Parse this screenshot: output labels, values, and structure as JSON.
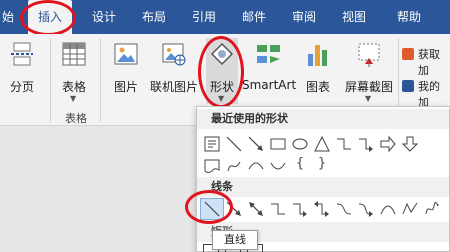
{
  "tabs": [
    {
      "label": "始"
    },
    {
      "label": "插入"
    },
    {
      "label": "设计"
    },
    {
      "label": "布局"
    },
    {
      "label": "引用"
    },
    {
      "label": "邮件"
    },
    {
      "label": "审阅"
    },
    {
      "label": "视图"
    },
    {
      "label": "帮助"
    }
  ],
  "ribbon": {
    "page_break": "分页",
    "table": "表格",
    "table_group": "表格",
    "picture": "图片",
    "online_picture": "联机图片",
    "shapes": "形状",
    "smartart": "SmartArt",
    "chart": "图表",
    "screenshot": "屏幕截图",
    "get_addins": "获取加",
    "my_addins": "我的加"
  },
  "shapes_panel": {
    "recent_header": "最近使用的形状",
    "lines_header": "线条",
    "partial_header": "矩形",
    "tooltip": "直线"
  },
  "colors": {
    "tab_bar": "#2b579a",
    "ribbon_bg": "#f3f3f3",
    "highlight_ring": "#e0141e",
    "selected_shape": "#cfe3f7"
  }
}
